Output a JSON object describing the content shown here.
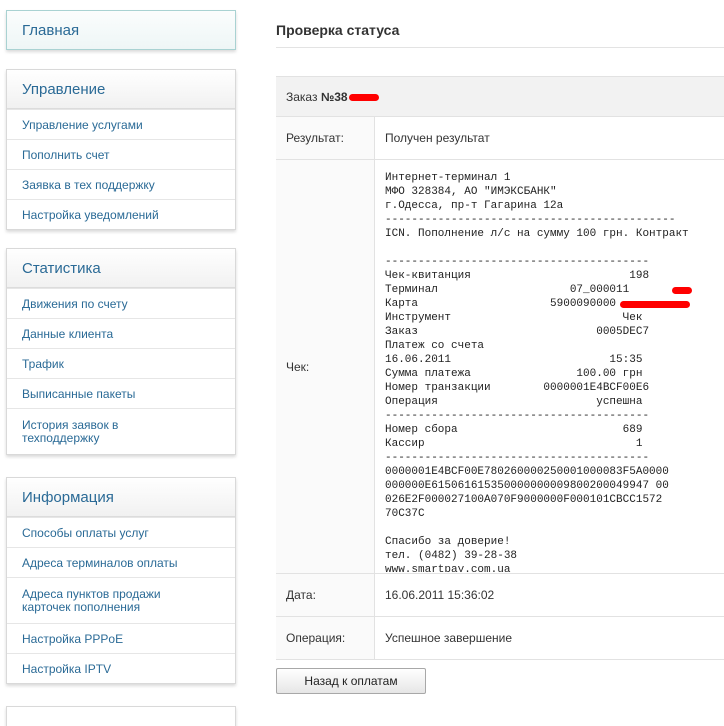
{
  "sidebar": {
    "main": {
      "label": "Главная"
    },
    "management": {
      "title": "Управление",
      "items": [
        {
          "label": "Управление услугами"
        },
        {
          "label": "Пополнить счет"
        },
        {
          "label": "Заявка в тех поддержку"
        },
        {
          "label": "Настройка уведомлений"
        }
      ]
    },
    "statistics": {
      "title": "Статистика",
      "items": [
        {
          "label": "Движения по счету"
        },
        {
          "label": "Данные клиента"
        },
        {
          "label": "Трафик"
        },
        {
          "label": "Выписанные пакеты"
        },
        {
          "label": "История заявок в\nтехподдержку"
        }
      ]
    },
    "information": {
      "title": "Информация",
      "items": [
        {
          "label": "Способы оплаты услуг"
        },
        {
          "label": "Адреса терминалов оплаты"
        },
        {
          "label": "Адреса пунктов продажи\nкарточек пополнения"
        },
        {
          "label": "Настройка PPPoE"
        },
        {
          "label": "Настройка IPTV"
        }
      ]
    }
  },
  "main": {
    "title": "Проверка статуса",
    "order": {
      "label": "Заказ",
      "number": "№38"
    },
    "rows": {
      "result": {
        "label": "Результат:",
        "value": "Получен результат"
      },
      "check": {
        "label": "Чек:"
      },
      "date": {
        "label": "Дата:",
        "value": "16.06.2011 15:36:02"
      },
      "operation": {
        "label": "Операция:",
        "value": "Успешное завершение"
      }
    },
    "receipt_lines": [
      "Интернет-терминал 1",
      "МФО 328384, АО \"ИМЭКСБАНК\"",
      "г.Одесса, пр-т Гагарина 12а",
      "--------------------------------------------",
      "ICN. Пополнение л/с на сумму 100 грн. Контракт",
      "",
      "----------------------------------------",
      "Чек-квитанция                        198",
      "Терминал                    07_000011",
      "Карта                    5900090000",
      "Инструмент                          Чек",
      "Заказ                           0005DEC7",
      "Платеж со счета",
      "16.06.2011                        15:35",
      "Сумма платежа                100.00 грн",
      "Номер транзакции        0000001E4BCF00E6",
      "Операция                        успешна",
      "----------------------------------------",
      "Номер сбора                         689",
      "Кассир                                1",
      "----------------------------------------",
      "0000001E4BCF00E780260000250001000083F5A0000",
      "000000E615061615350000000009800200049947 00",
      "026E2F000027100A070F9000000F000101CBCC1572",
      "70C37C",
      "",
      "Спасибо за доверие!",
      "тел. (0482) 39-28-38",
      "www.smartpay.com.ua"
    ],
    "back_button": "Назад к оплатам"
  },
  "colors": {
    "link": "#2a6a96",
    "redaction": "#ff0000"
  }
}
